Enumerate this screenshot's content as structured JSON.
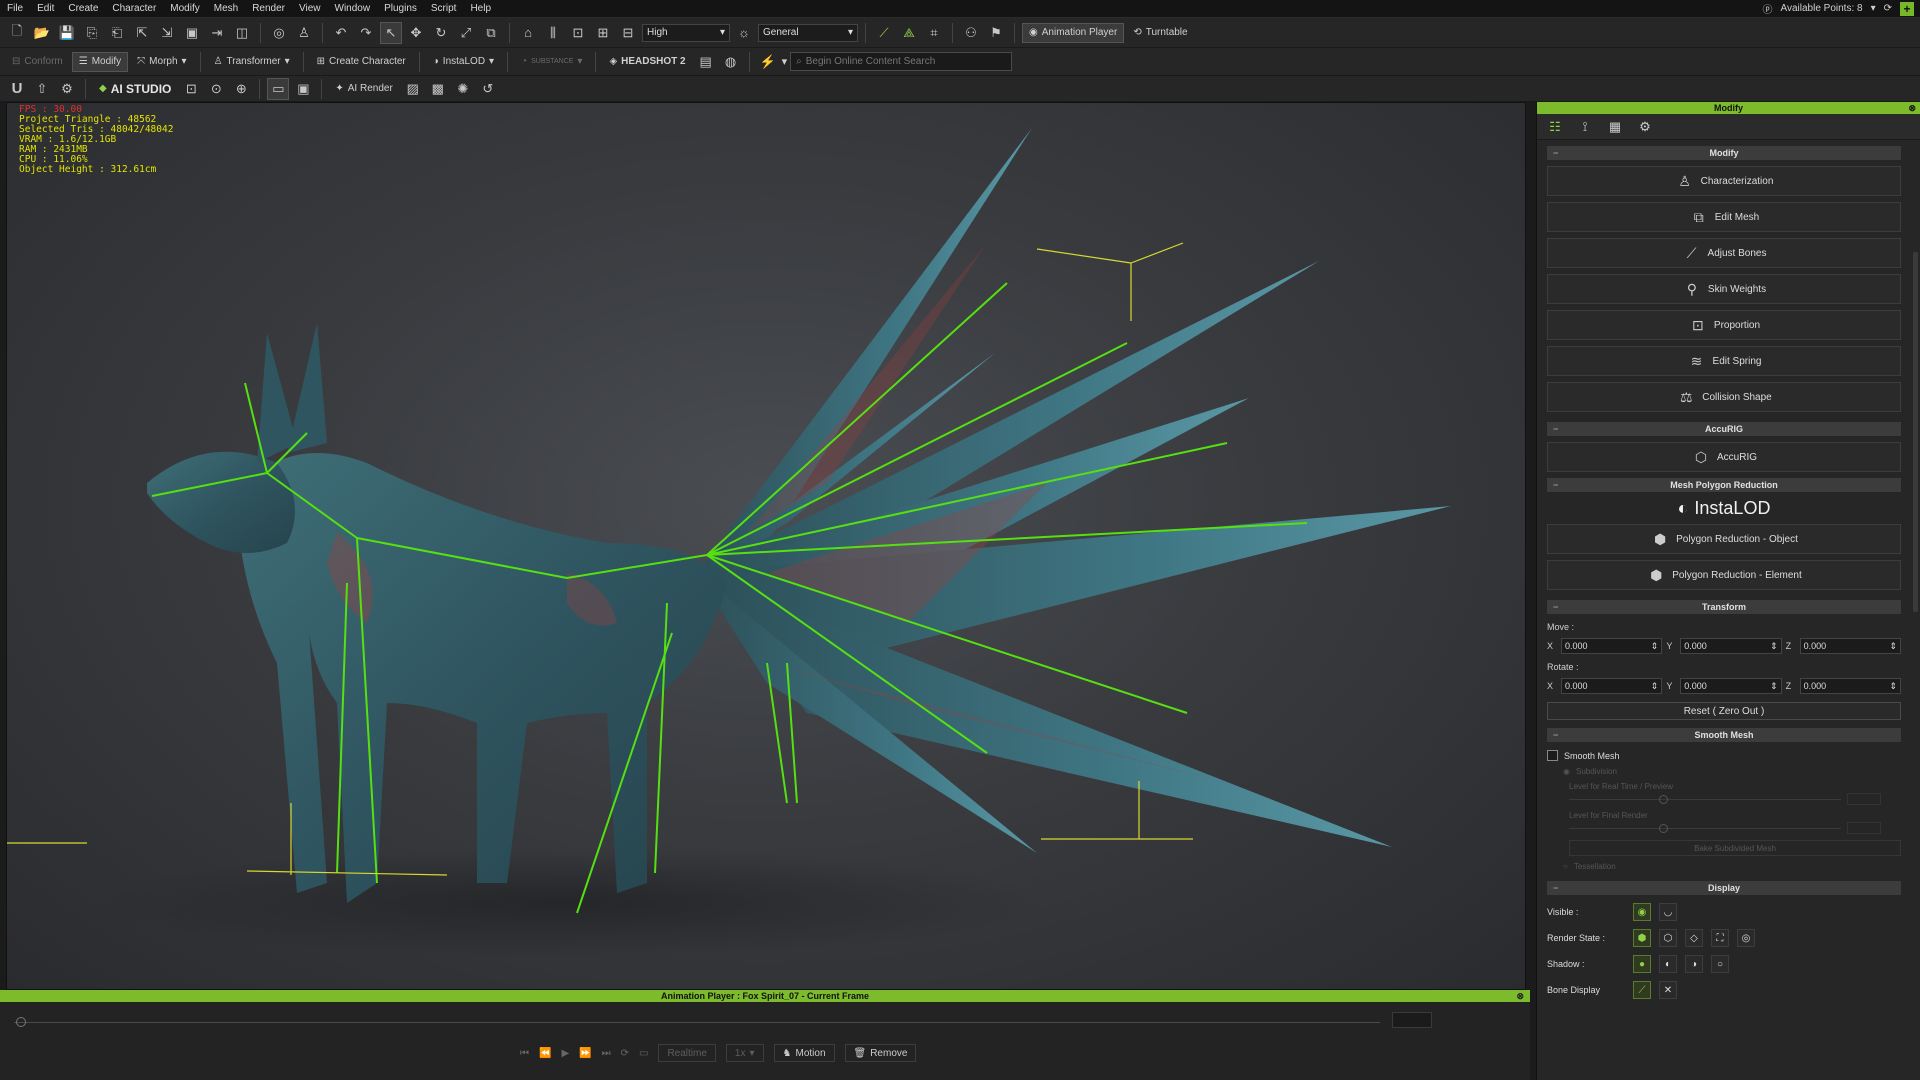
{
  "menu": {
    "items": [
      "File",
      "Edit",
      "Create",
      "Character",
      "Modify",
      "Mesh",
      "Render",
      "View",
      "Window",
      "Plugins",
      "Script",
      "Help"
    ],
    "available_points": "Available Points: 8"
  },
  "toolbar1": {
    "quality": "High",
    "mode": "General",
    "animation_player": "Animation Player",
    "turntable": "Turntable"
  },
  "toolbar2": {
    "conform": "Conform",
    "modify": "Modify",
    "morph": "Morph",
    "transformer": "Transformer",
    "create_character": "Create Character",
    "instalod": "InstaLOD",
    "substance": "SUBSTANCE",
    "headshot": "HEADSHOT 2",
    "search_placeholder": "Begin Online Content Search"
  },
  "toolbar3": {
    "u_logo": "U",
    "ai_studio": "AI STUDIO",
    "ai_render": "AI Render"
  },
  "stats": {
    "fps": "FPS : 30.00",
    "project_triangle": "Project Triangle : 48562",
    "selected_tris": "Selected Tris : 48042/48042",
    "vram": "VRAM : 1.6/12.1GB",
    "ram": "RAM : 2431MB",
    "cpu": "CPU : 11.06%",
    "object_height": "Object Height : 312.61cm"
  },
  "animation_player": {
    "title": "Animation Player : Fox Spirit_07 - Current Frame",
    "frame": "0",
    "realtime": "Realtime",
    "speed": "1x",
    "motion": "Motion",
    "remove": "Remove"
  },
  "panel": {
    "title": "Modify",
    "sections": {
      "modify": "Modify",
      "accurig": "AccuRIG",
      "mesh_reduction": "Mesh Polygon Reduction",
      "transform": "Transform",
      "smooth_mesh": "Smooth Mesh",
      "display": "Display"
    },
    "modify_buttons": [
      "Characterization",
      "Edit Mesh",
      "Adjust Bones",
      "Skin Weights",
      "Proportion",
      "Edit Spring",
      "Collision Shape"
    ],
    "accurig_button": "AccuRIG",
    "instalod_logo": "InstaLOD",
    "reduction_buttons": [
      "Polygon Reduction - Object",
      "Polygon Reduction - Element"
    ],
    "transform": {
      "move_label": "Move :",
      "rotate_label": "Rotate :",
      "move": {
        "x": "0.000",
        "y": "0.000",
        "z": "0.000"
      },
      "rotate": {
        "x": "0.000",
        "y": "0.000",
        "z": "0.000"
      },
      "reset": "Reset ( Zero Out )"
    },
    "smooth": {
      "smooth_mesh": "Smooth Mesh",
      "subdivision": "Subdivision",
      "level_realtime": "Level for Real Time / Preview",
      "level_render": "Level for Final Render",
      "bake": "Bake Subdivided Mesh",
      "tessellation": "Tessellation",
      "level_realtime_value": "1",
      "level_render_value": "1"
    },
    "display": {
      "visible": "Visible :",
      "render_state": "Render State :",
      "shadow": "Shadow :",
      "bone_display": "Bone Display"
    }
  },
  "colors": {
    "accent": "#7cbb2c",
    "bone": "#55e012"
  }
}
